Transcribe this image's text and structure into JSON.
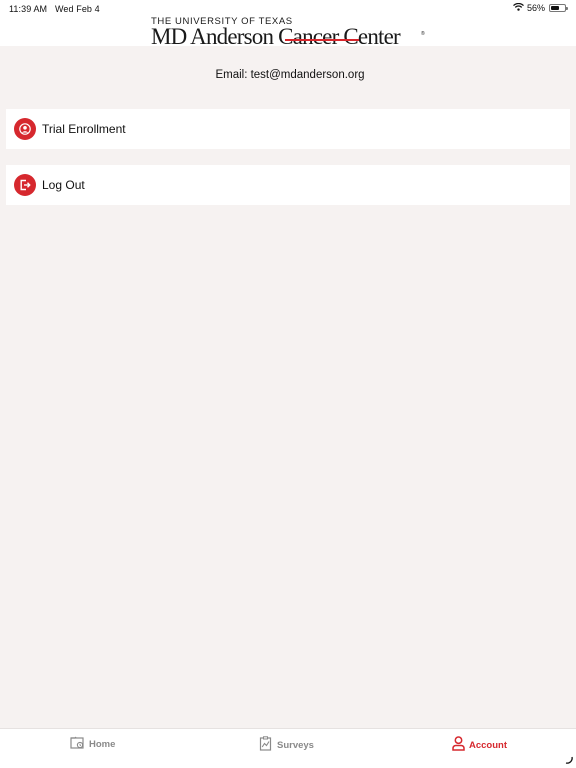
{
  "status_bar": {
    "time": "11:39 AM",
    "date": "Wed Feb 4",
    "battery": "56%"
  },
  "header": {
    "logo_top": "THE UNIVERSITY OF TEXAS",
    "logo_main": "MD Anderson Cancer Center",
    "logo_reg": "®"
  },
  "account": {
    "email": "Email: test@mdanderson.org"
  },
  "menu": {
    "items": [
      {
        "label": "Trial Enrollment",
        "icon": "account-circle-icon"
      },
      {
        "label": "Log Out",
        "icon": "logout-icon"
      }
    ]
  },
  "tabbar": {
    "tabs": [
      {
        "label": "Home",
        "icon": "home-icon",
        "active": false
      },
      {
        "label": "Surveys",
        "icon": "surveys-icon",
        "active": false
      },
      {
        "label": "Account",
        "icon": "account-icon",
        "active": true
      }
    ]
  },
  "colors": {
    "accent": "#d6282e",
    "background": "#f6f2f1",
    "inactive_tab": "#8a8a8a"
  }
}
